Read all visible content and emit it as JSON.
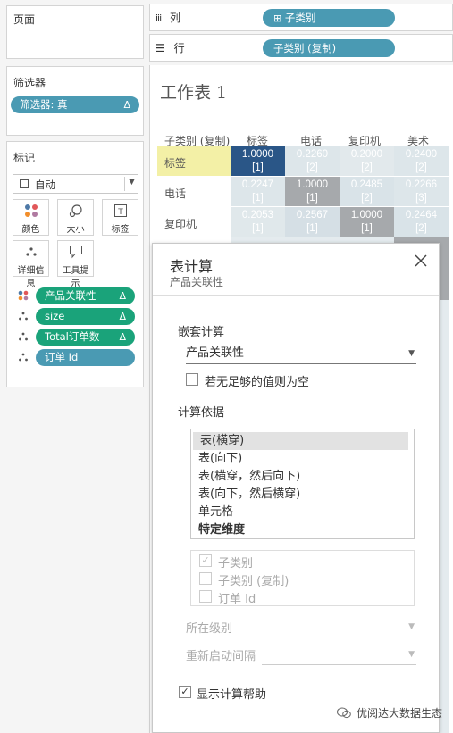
{
  "left": {
    "pages_title": "页面",
    "filters_title": "筛选器",
    "filter_pill": "筛选器: 真",
    "marks_title": "标记",
    "marks_type": "自动",
    "mark_buttons": [
      "颜色",
      "大小",
      "标签",
      "详细信息",
      "工具提示"
    ],
    "mark_pills": [
      {
        "label": "产品关联性",
        "kind": "color"
      },
      {
        "label": "size",
        "kind": "detail"
      },
      {
        "label": "Total订单数",
        "kind": "detail"
      },
      {
        "label": "订单 Id",
        "kind": "detail"
      }
    ],
    "delta_symbol": "Δ"
  },
  "shelves": {
    "columns_label": "列",
    "columns_pill": "子类别",
    "rows_label": "行",
    "rows_pill": "子类别 (复制)"
  },
  "sheet": {
    "title": "工作表 1",
    "row_header_title": "子类别 (复制)",
    "col_headers": [
      "标签",
      "电话",
      "复印机",
      "美术"
    ],
    "row_headers": [
      "标签",
      "电话",
      "复印机"
    ],
    "cells": [
      [
        {
          "v": "1.0000",
          "r": "[1]"
        },
        {
          "v": "0.2260",
          "r": "[2]"
        },
        {
          "v": "0.2000",
          "r": "[2]"
        },
        {
          "v": "0.2400",
          "r": "[2]"
        }
      ],
      [
        {
          "v": "0.2247",
          "r": "[1]"
        },
        {
          "v": "1.0000",
          "r": "[1]"
        },
        {
          "v": "0.2485",
          "r": "[2]"
        },
        {
          "v": "0.2266",
          "r": "[3]"
        }
      ],
      [
        {
          "v": "0.2053",
          "r": "[1]"
        },
        {
          "v": "0.2567",
          "r": "[1]"
        },
        {
          "v": "1.0000",
          "r": "[1]"
        },
        {
          "v": "0.2464",
          "r": "[2]"
        }
      ]
    ]
  },
  "dialog": {
    "title": "表计算",
    "subtitle": "产品关联性",
    "nested_label": "嵌套计算",
    "nested_value": "产品关联性",
    "null_if_insufficient": "若无足够的值则为空",
    "compute_using_label": "计算依据",
    "compute_options": [
      "表(横穿)",
      "表(向下)",
      "表(横穿，然后向下)",
      "表(向下，然后横穿)",
      "单元格",
      "特定维度"
    ],
    "dimensions": [
      {
        "label": "子类别",
        "checked": true
      },
      {
        "label": "子类别 (复制)",
        "checked": false
      },
      {
        "label": "订单 Id",
        "checked": false
      }
    ],
    "level_label": "所在级别",
    "restart_label": "重新启动间隔",
    "show_help": "显示计算帮助"
  },
  "watermark": "优阅达大数据生态"
}
